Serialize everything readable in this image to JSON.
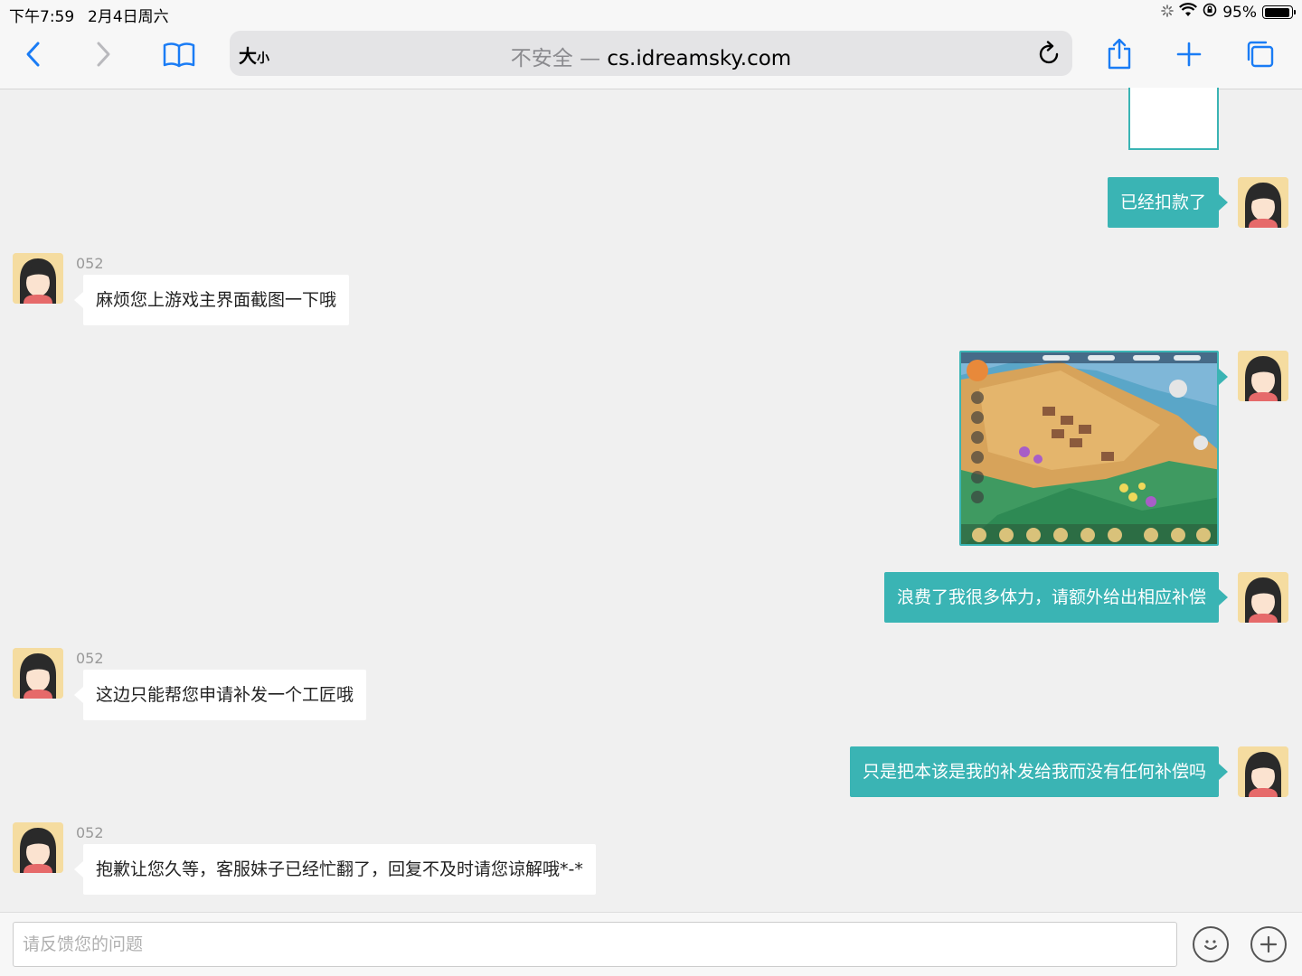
{
  "status_bar": {
    "time": "下午7:59",
    "date": "2月4日周六",
    "battery_text": "95%",
    "battery_level": 0.95
  },
  "browser": {
    "text_size_big": "大",
    "text_size_small": "小",
    "security_label": "不安全 —",
    "host": "cs.idreamsky.com",
    "icons": [
      "back-icon",
      "forward-icon",
      "bookmarks-icon",
      "reload-icon",
      "share-icon",
      "new-tab-icon",
      "tabs-icon"
    ]
  },
  "chat": {
    "agent_name": "052",
    "messages": [
      {
        "from": "user",
        "type": "text",
        "text": "已经扣款了"
      },
      {
        "from": "agent",
        "type": "text",
        "text": "麻烦您上游戏主界面截图一下哦"
      },
      {
        "from": "user",
        "type": "image",
        "alt": "game-screenshot"
      },
      {
        "from": "user",
        "type": "text",
        "text": "浪费了我很多体力，请额外给出相应补偿"
      },
      {
        "from": "agent",
        "type": "text",
        "text": "这边只能帮您申请补发一个工匠哦"
      },
      {
        "from": "user",
        "type": "text",
        "text": "只是把本该是我的补发给我而没有任何补偿吗"
      },
      {
        "from": "agent",
        "type": "text",
        "text": "抱歉让您久等，客服妹子已经忙翻了，回复不及时请您谅解哦*-*"
      }
    ]
  },
  "composer": {
    "placeholder": "请反馈您的问题",
    "value": ""
  },
  "colors": {
    "accent": "#3ab4b4",
    "chat_bg": "#f0f0f0",
    "ios_blue": "#1a7cf5"
  }
}
